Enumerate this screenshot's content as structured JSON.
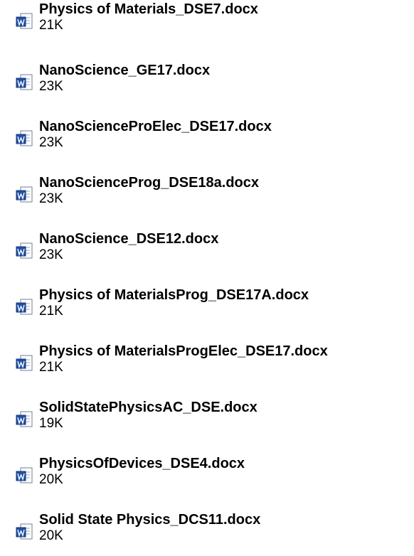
{
  "files": [
    {
      "name": "Physics of Materials_DSE7.docx",
      "size": "21K",
      "icon": "word-document-icon"
    },
    {
      "name": "NanoScience_GE17.docx",
      "size": "23K",
      "icon": "word-document-icon"
    },
    {
      "name": "NanoScienceProElec_DSE17.docx",
      "size": "23K",
      "icon": "word-document-icon"
    },
    {
      "name": "NanoScienceProg_DSE18a.docx",
      "size": "23K",
      "icon": "word-document-icon"
    },
    {
      "name": "NanoScience_DSE12.docx",
      "size": "23K",
      "icon": "word-document-icon"
    },
    {
      "name": "Physics of MaterialsProg_DSE17A.docx",
      "size": "21K",
      "icon": "word-document-icon"
    },
    {
      "name": "Physics of MaterialsProgElec_DSE17.docx",
      "size": "21K",
      "icon": "word-document-icon"
    },
    {
      "name": "SolidStatePhysicsAC_DSE.docx",
      "size": "19K",
      "icon": "word-document-icon"
    },
    {
      "name": "PhysicsOfDevices_DSE4.docx",
      "size": "20K",
      "icon": "word-document-icon"
    },
    {
      "name": "Solid State Physics_DCS11.docx",
      "size": "20K",
      "icon": "word-document-icon"
    }
  ],
  "colors": {
    "text": "#000000",
    "background": "#ffffff",
    "icon_blue": "#1f4fa6",
    "icon_page": "#ffffff",
    "icon_border": "#6e7f99"
  }
}
